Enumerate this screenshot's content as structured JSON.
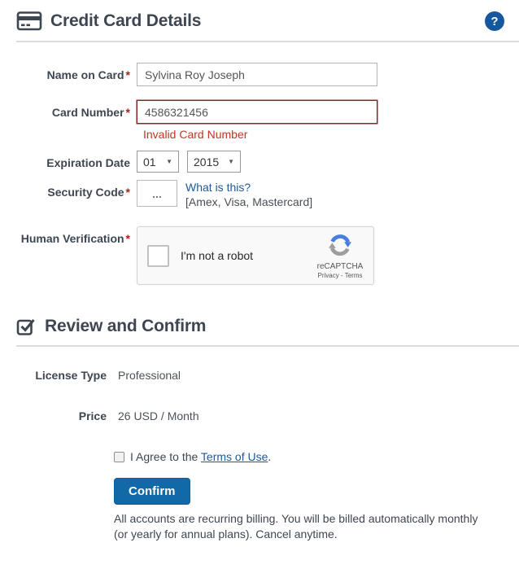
{
  "colors": {
    "heading_text": "#3e4651",
    "link_blue": "#1a5b97",
    "help_badge_blue": "#15589e",
    "confirm_button_blue": "#1269a7",
    "error_red": "#c13524",
    "error_border_red": "#8e2323",
    "required_mark_red": "#b31b1b",
    "recaptcha_arrow_blue": "#4a7de0",
    "recaptcha_arrow_gray": "#9e9e9e"
  },
  "common": {
    "required_mark": "*",
    "help_glyph": "?"
  },
  "card_section": {
    "title": "Credit Card Details",
    "name_field": {
      "label": "Name on Card",
      "value": "Sylvina Roy Joseph"
    },
    "number_field": {
      "label": "Card Number",
      "value": "4586321456",
      "error": "Invalid Card Number"
    },
    "expiration_field": {
      "label": "Expiration Date",
      "month": "01",
      "year": "2015",
      "arrow": "▼"
    },
    "security_field": {
      "label": "Security Code",
      "placeholder": "...",
      "link": "What is this?",
      "hint": "[Amex, Visa, Mastercard]"
    },
    "verification_field": {
      "label": "Human Verification"
    },
    "recaptcha": {
      "label": "I'm not a robot",
      "brand": "reCAPTCHA",
      "privacy": "Privacy",
      "sep": " - ",
      "terms": "Terms"
    }
  },
  "review_section": {
    "title": "Review and Confirm",
    "license": {
      "label": "License Type",
      "value": "Professional"
    },
    "price": {
      "label": "Price",
      "value": "26 USD / Month"
    },
    "agree": {
      "prefix": "I Agree to the ",
      "link": "Terms of Use",
      "suffix": "."
    },
    "confirm_label": "Confirm",
    "note": "All accounts are recurring billing. You will be billed automatically monthly (or yearly for annual plans). Cancel anytime."
  }
}
